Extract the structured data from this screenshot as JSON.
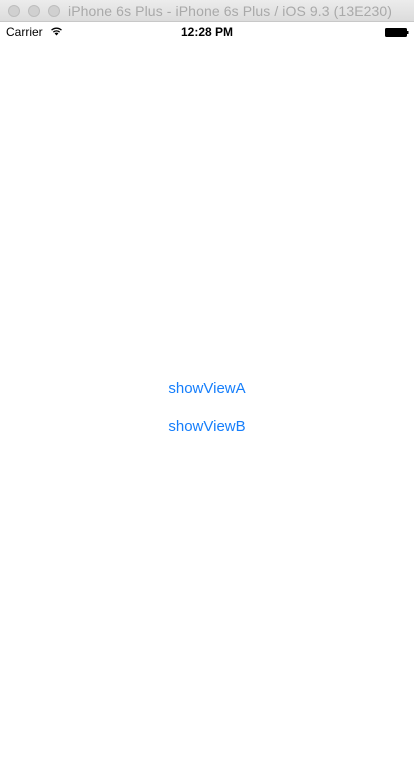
{
  "window": {
    "title": "iPhone 6s Plus - iPhone 6s Plus / iOS 9.3 (13E230)"
  },
  "status_bar": {
    "carrier": "Carrier",
    "time": "12:28 PM",
    "icons": [
      "wifi-icon",
      "battery-icon"
    ]
  },
  "content": {
    "buttons": [
      {
        "label": "showViewA"
      },
      {
        "label": "showViewB"
      }
    ]
  },
  "colors": {
    "tint": "#157efb",
    "background": "#ffffff"
  }
}
